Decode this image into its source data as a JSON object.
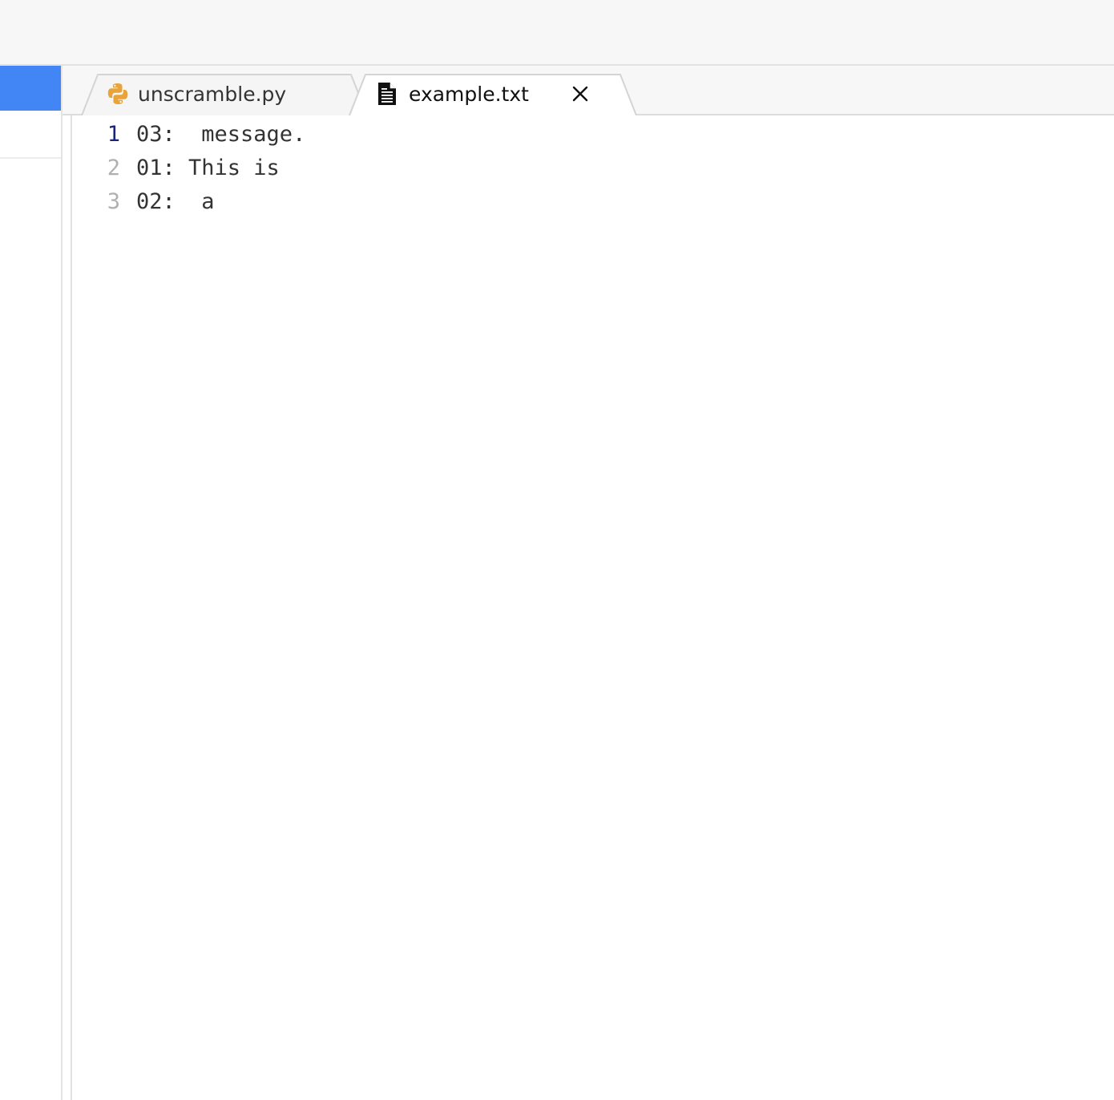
{
  "tabs": [
    {
      "label": "unscramble.py",
      "icon": "python-icon",
      "active": false
    },
    {
      "label": "example.txt",
      "icon": "text-file-icon",
      "active": true,
      "close_icon": "close-icon"
    }
  ],
  "editor": {
    "current_line": 1,
    "lines": [
      {
        "number": "1",
        "text": "03:  message."
      },
      {
        "number": "2",
        "text": "01: This is"
      },
      {
        "number": "3",
        "text": "02:  a"
      }
    ]
  },
  "colors": {
    "accent": "#4285f4",
    "python_icon": "#e8a43a",
    "current_line_number": "#1a237e"
  }
}
